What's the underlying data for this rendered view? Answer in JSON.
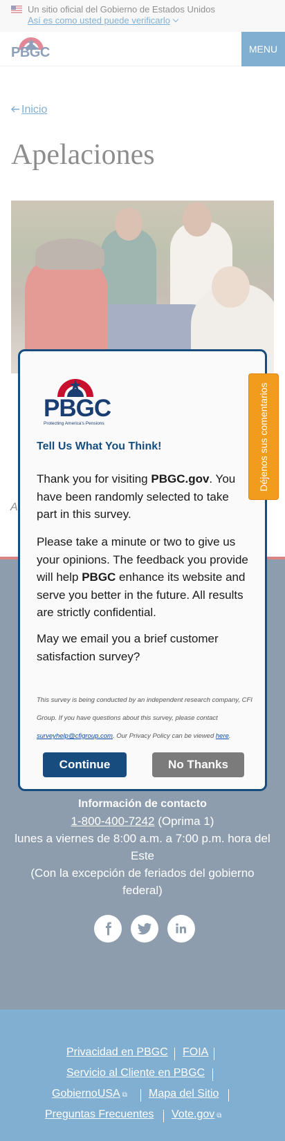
{
  "banner": {
    "official_text": "Un sitio oficial del Gobierno de Estados Unidos",
    "verify_link": "Así es como usted puede verificarlo"
  },
  "header": {
    "logo_text": "PBGC",
    "menu_label": "MENU"
  },
  "breadcrumb": {
    "home_label": "Inicio"
  },
  "page": {
    "title": "Apelaciones",
    "caption_partial": "A"
  },
  "footer": {
    "contact_heading": "Información de contacto",
    "phone": "1-800-400-7242",
    "phone_suffix": " (Oprima 1)",
    "hours": "lunes a viernes de 8:00 a.m. a 7:00 p.m. hora del Este",
    "holiday_note": "(Con la excepción de feriados del gobierno federal)",
    "social": [
      "facebook-icon",
      "twitter-icon",
      "linkedin-icon"
    ],
    "links": [
      {
        "label": "Privacidad en PBGC"
      },
      {
        "label": "FOIA"
      },
      {
        "label": "Servicio al Cliente en PBGC"
      },
      {
        "label": "GobiernoUSA",
        "external": true
      },
      {
        "label": "Mapa del Sitio"
      },
      {
        "label": "Preguntas Frecuentes"
      },
      {
        "label": "Vote.gov",
        "external": true
      }
    ]
  },
  "survey_modal": {
    "logo_text": "PBGC",
    "logo_tagline": "Protecting America's Pensions",
    "title": "Tell Us What You Think!",
    "para1_prefix": "Thank you for visiting ",
    "para1_bold": "PBGC.gov",
    "para1_suffix": ". You have been randomly selected to take part in this survey.",
    "para2_prefix": "Please take a minute or two to give us your opinions. The feedback you provide will help ",
    "para2_bold": "PBGC",
    "para2_suffix": " enhance its website and serve you better in the future. All results are strictly confidential.",
    "para3": "May we email you a brief customer satisfaction survey?",
    "fine_print_1": "This survey is being conducted by an independent research company, CFI Group. If you have questions about this survey, please contact ",
    "fine_print_email": "surveyhelp@cfigroup.com",
    "fine_print_2": ". Our Privacy Policy can be viewed ",
    "fine_print_link": "here",
    "fine_print_3": ".",
    "continue_label": "Continue",
    "no_thanks_label": "No Thanks"
  },
  "feedback_tab": {
    "label": "Déjenos sus comentarios"
  },
  "colors": {
    "primary": "#005ea2",
    "modal_border": "#164c7e",
    "feedback_orange": "#f29c1d",
    "footer_dark": "#1b3a5b"
  }
}
